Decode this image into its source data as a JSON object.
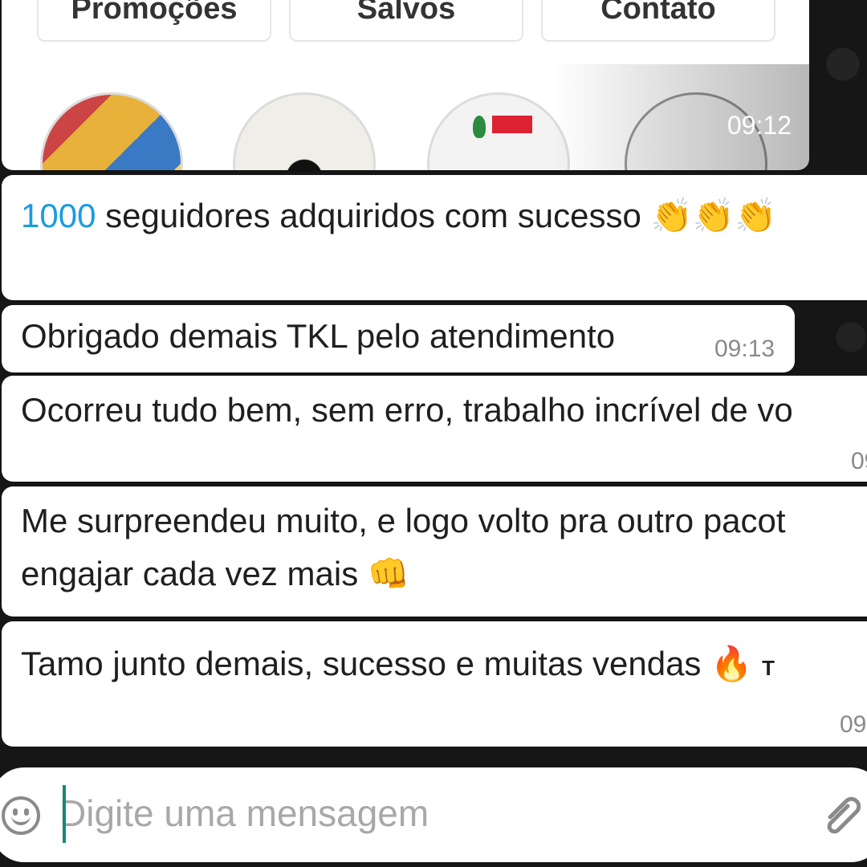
{
  "card": {
    "buttons": [
      "Promoções",
      "Salvos",
      "Contato"
    ],
    "time": "09:12"
  },
  "messages": [
    {
      "number": "1000",
      "text": " seguidores adquiridos com sucesso ",
      "emoji": "👏👏👏",
      "time": ""
    },
    {
      "text": "Obrigado demais TKL pelo atendimento",
      "time": "09:13"
    },
    {
      "text": "Ocorreu tudo bem, sem erro, trabalho incrível de vo",
      "time": "09"
    },
    {
      "line1": "Me surpreendeu muito, e logo volto pra outro pacot",
      "line2": "engajar cada vez mais ",
      "emoji": "👊",
      "time": ""
    },
    {
      "text": "Tamo junto demais, sucesso e muitas vendas ",
      "emoji": "🔥",
      "trailing": "T",
      "time": "09"
    }
  ],
  "input": {
    "placeholder": "Digite uma mensagem"
  },
  "icons": {
    "emoji": "emoji-icon",
    "attach": "paperclip-icon"
  }
}
